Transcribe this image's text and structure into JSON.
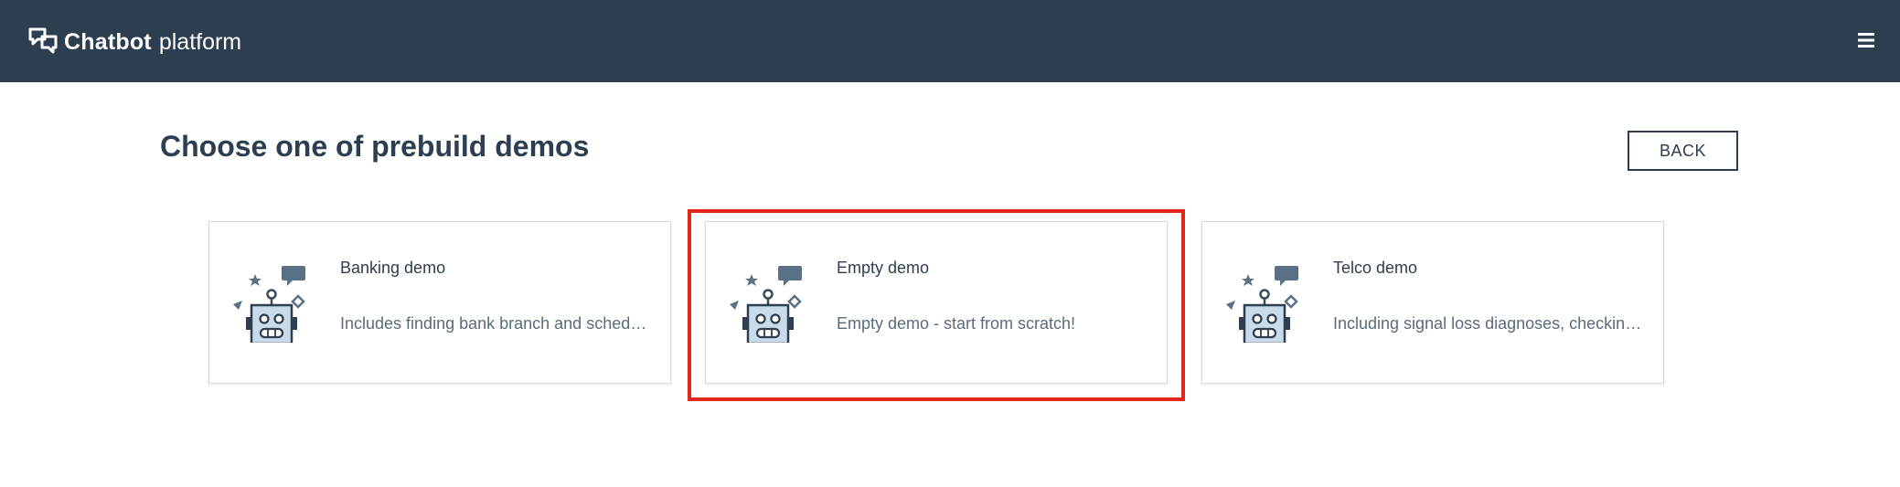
{
  "header": {
    "brand_strong": "Chatbot",
    "brand_light": "platform",
    "logo_icon": "chat-bubbles-icon",
    "menu_icon": "hamburger-menu-icon",
    "background_color": "#2d3e50"
  },
  "main": {
    "title": "Choose one of prebuild demos",
    "back_label": "BACK"
  },
  "demos": [
    {
      "title": "Banking demo",
      "description": "Includes finding bank branch and scheduling an appointment",
      "icon": "robot-icon"
    },
    {
      "title": "Empty demo",
      "description": "Empty demo - start from scratch!",
      "icon": "robot-icon",
      "highlighted": true
    },
    {
      "title": "Telco demo",
      "description": "Including signal loss diagnoses, checking balance and more",
      "icon": "robot-icon"
    }
  ],
  "colors": {
    "accent": "#2d3e50",
    "highlight": "#e2261a",
    "text_muted": "#5b6b7b"
  }
}
